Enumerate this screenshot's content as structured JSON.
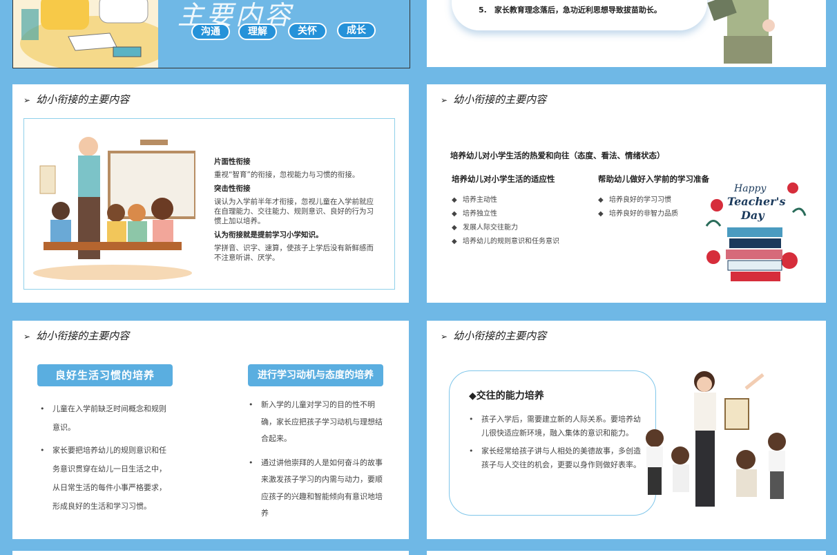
{
  "slide1": {
    "title": "主要内容",
    "tags": [
      "沟通",
      "理解",
      "关怀",
      "成长"
    ]
  },
  "slide2": {
    "item5": "5.　家长教育理念落后，急功近利思想导致拔苗助长。"
  },
  "slide3": {
    "heading": "幼小衔接的主要内容",
    "h1": "片面性衔接",
    "p1": "重视“智育”的衔接，忽视能力与习惯的衔接。",
    "h2": "突击性衔接",
    "p2": "误认为入学前半年才衔接，忽视儿童在入学前就应在自理能力、交往能力、规则意识、良好的行为习惯上加以培养。",
    "h3": "认为衔接就是提前学习小学知识。",
    "p3": "学拼音、识字、速算，使孩子上学后没有新鲜感而不注意听讲、厌学。"
  },
  "slide4": {
    "heading": "幼小衔接的主要内容",
    "top": "培养幼儿对小学生活的热爱和向往（态度、看法、情绪状态）",
    "left_title": "培养幼儿对小学生活的适应性",
    "left_items": [
      "培养主动性",
      "培养独立性",
      "发展人际交往能力",
      "培养幼儿的规则意识和任务意识"
    ],
    "right_title": "帮助幼儿做好入学前的学习准备",
    "right_items": [
      "培养良好的学习习惯",
      "培养良好的非智力品质"
    ]
  },
  "slide5": {
    "heading": "幼小衔接的主要内容",
    "badge_left": "良好生活习惯的培养",
    "left_items": [
      "儿童在入学前缺乏时间概念和规则意识。",
      "家长要把培养幼儿的规则意识和任务意识贯穿在幼儿一日生活之中，从日常生活的每件小事严格要求，形成良好的生活和学习习惯。"
    ],
    "badge_right": "进行学习动机与态度的培养",
    "right_items": [
      "新入学的儿童对学习的目的性不明确，家长应把孩子学习动机与理想结合起来。",
      "通过讲他崇拜的人是如何奋斗的故事来激发孩子学习的内需与动力，要顺应孩子的兴趣和智能倾向有意识地培养"
    ]
  },
  "slide6": {
    "heading": "幼小衔接的主要内容",
    "title": "◆交往的能力培养",
    "items": [
      "孩子入学后，需要建立新的人际关系。要培养幼儿很快适应新环境，融入集体的意识和能力。",
      "家长经常给孩子讲与人相处的美德故事，多创造孩子与人交往的机会，更要以身作则做好表率。"
    ]
  },
  "colors": {
    "frame": "#6fb8e6",
    "accent": "#2592d9",
    "badge": "#5aaee0"
  }
}
